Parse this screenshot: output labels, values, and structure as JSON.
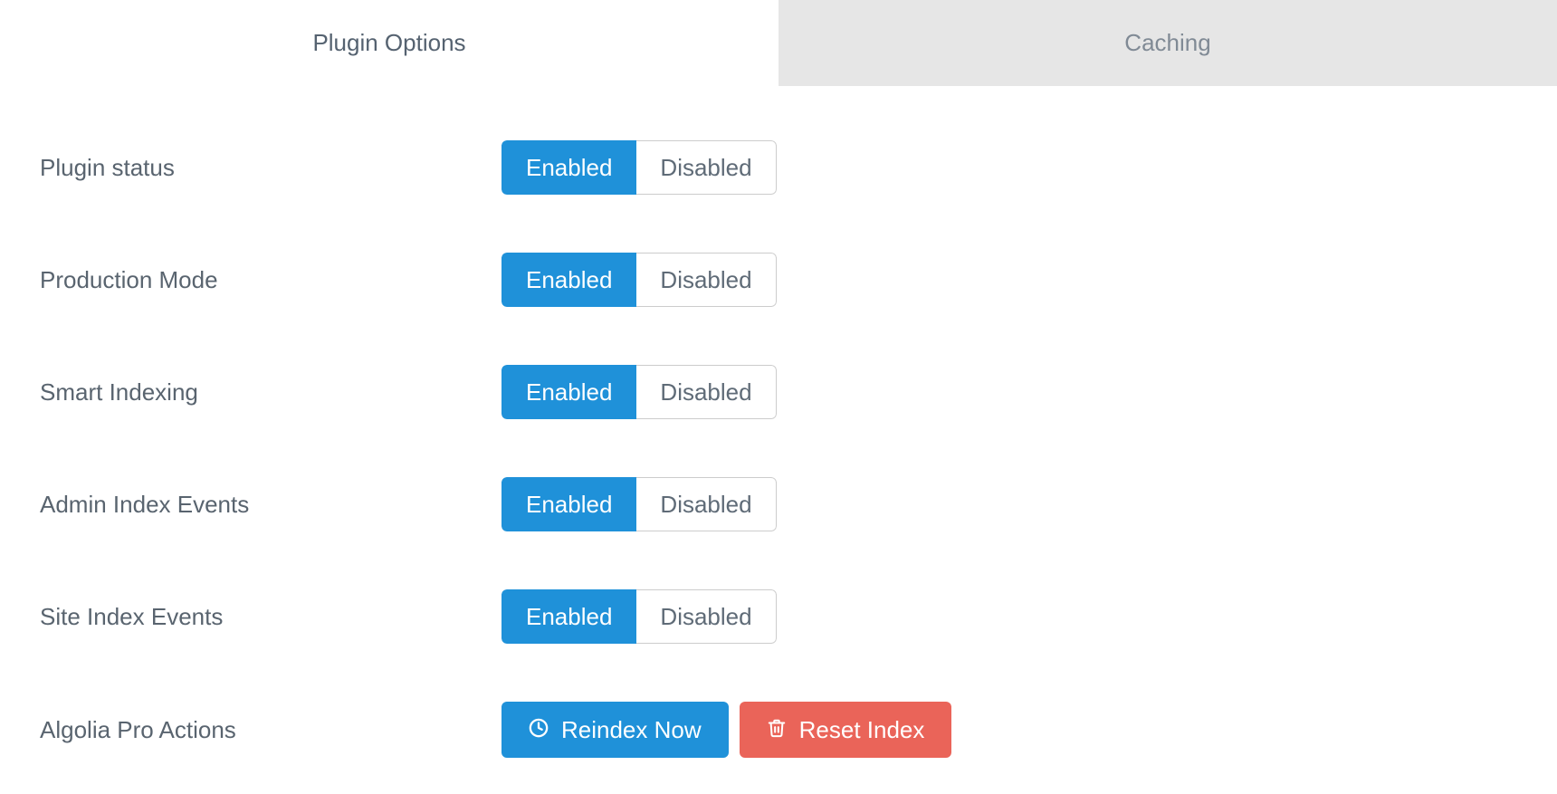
{
  "tabs": {
    "plugin_options": "Plugin Options",
    "caching": "Caching"
  },
  "rows": {
    "plugin_status": {
      "label": "Plugin status",
      "enabled": "Enabled",
      "disabled": "Disabled"
    },
    "production_mode": {
      "label": "Production Mode",
      "enabled": "Enabled",
      "disabled": "Disabled"
    },
    "smart_indexing": {
      "label": "Smart Indexing",
      "enabled": "Enabled",
      "disabled": "Disabled"
    },
    "admin_index_events": {
      "label": "Admin Index Events",
      "enabled": "Enabled",
      "disabled": "Disabled"
    },
    "site_index_events": {
      "label": "Site Index Events",
      "enabled": "Enabled",
      "disabled": "Disabled"
    },
    "algolia_pro_actions": {
      "label": "Algolia Pro Actions",
      "reindex": "Reindex Now",
      "reset": "Reset Index"
    }
  }
}
